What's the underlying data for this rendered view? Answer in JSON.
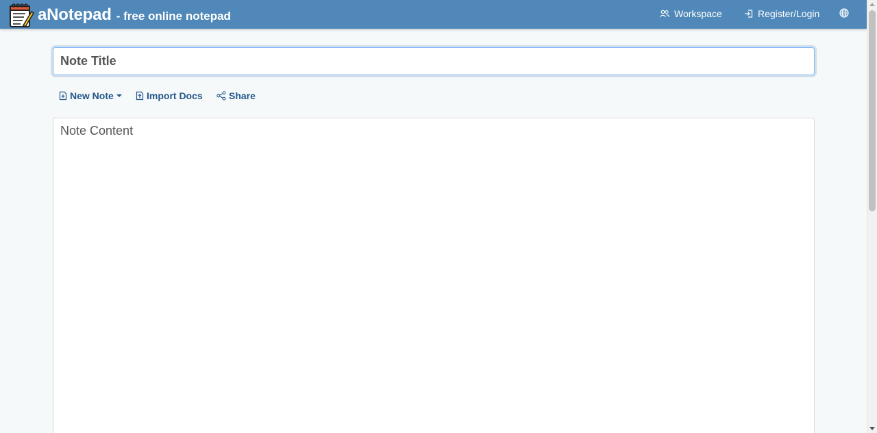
{
  "header": {
    "brand_name": "aNotepad",
    "tagline": "- free online notepad",
    "nav": {
      "workspace": "Workspace",
      "register_login": "Register/Login"
    },
    "icons": {
      "logo": "notepad-logo-icon",
      "workspace": "people-icon",
      "register_login": "login-arrow-icon",
      "language": "globe-icon"
    }
  },
  "editor": {
    "title_placeholder": "Note Title",
    "content_placeholder": "Note Content"
  },
  "toolbar": {
    "new_note": "New Note",
    "import_docs": "Import Docs",
    "share": "Share"
  },
  "colors": {
    "navbar": "#4f88b9",
    "link": "#23578c",
    "background": "#f6f9f9"
  }
}
